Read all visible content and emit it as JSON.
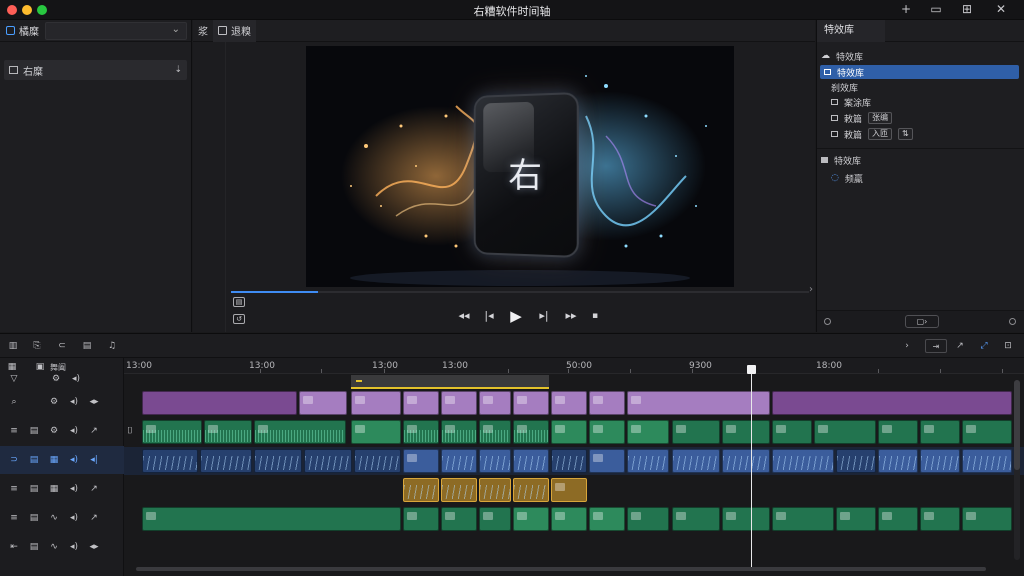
{
  "window": {
    "title": "右糟软件时间轴",
    "controls": [
      "+",
      "▭",
      "⊞",
      "✕"
    ]
  },
  "left_panel": {
    "tab_label": "橘糜",
    "folder_label": "右糜",
    "sort_icon": "sort-down-icon"
  },
  "viewer": {
    "tab_left": "浆",
    "tab_active": "退糗",
    "device_text": "右",
    "progress_fraction": 0.15,
    "mini_btn_1": "▤",
    "mini_btn_2": "↺"
  },
  "inspector": {
    "title": "特效库",
    "section1_label": "特效库",
    "items": [
      {
        "label": "特效库",
        "icon": "square-icon",
        "selected": true
      },
      {
        "label": "刹效库",
        "icon": "none",
        "selected": false
      },
      {
        "label": "案涂库",
        "icon": "square-icon",
        "selected": false
      },
      {
        "label": "敕篇",
        "icon": "folder-icon",
        "selected": false,
        "pill": "张编"
      },
      {
        "label": "敕篇",
        "icon": "folder-icon",
        "selected": false,
        "pill": "入匝",
        "pill2": "⇅"
      }
    ],
    "section2_label": "特效库",
    "section2_item": "频羸",
    "footer_seg": "▢›"
  },
  "timeline": {
    "toolbar_left_icons": [
      "media-icon",
      "clip-icon",
      "link-icon",
      "folder-icon",
      "audio-icon"
    ],
    "toolbar_right_btns": [
      "⇥",
      "↗",
      "⤢",
      "⊡"
    ],
    "header_top_label": "舞阖",
    "ruler_labels": [
      "13:00",
      "13:00",
      "13:00",
      "13:00",
      "50:00",
      "9300",
      "18:00"
    ]
  }
}
